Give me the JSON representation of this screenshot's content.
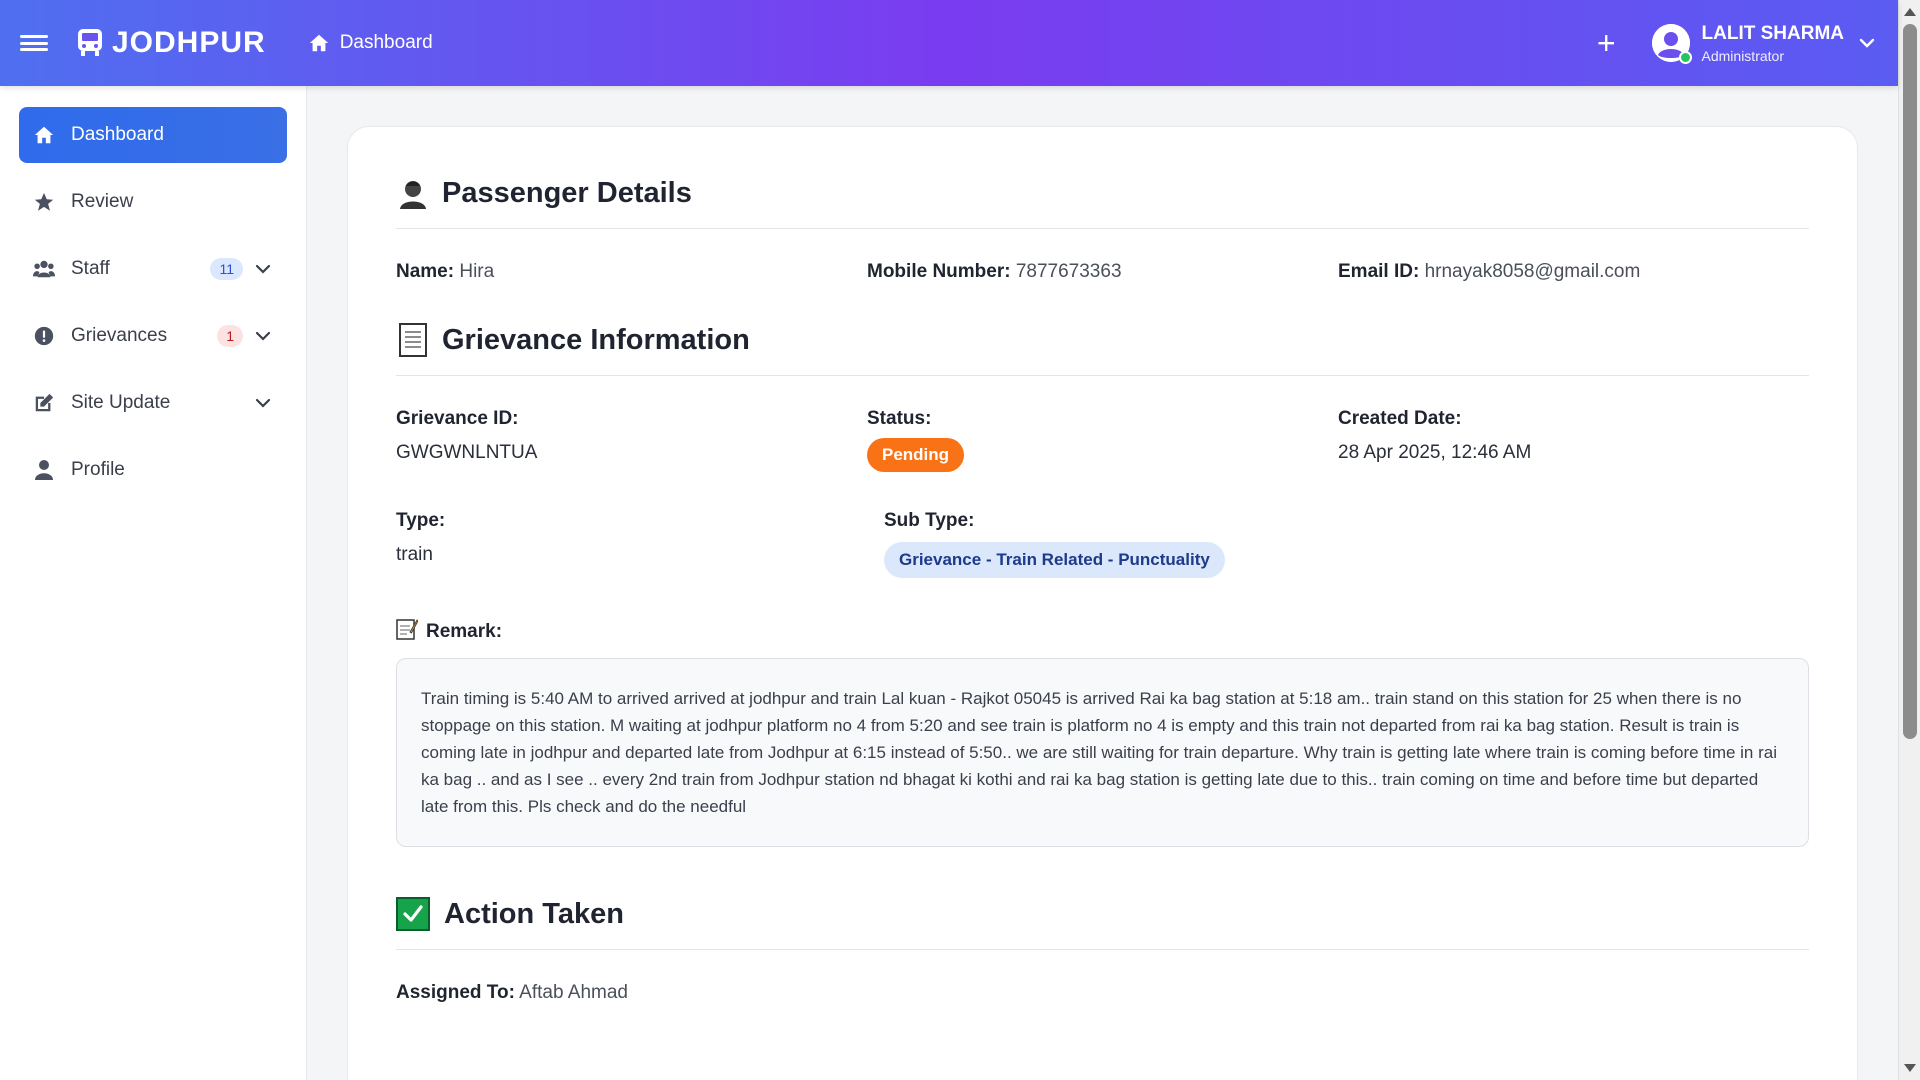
{
  "header": {
    "brand": "JODHPUR",
    "breadcrumb": "Dashboard",
    "user_name": "LALIT SHARMA",
    "user_role": "Administrator"
  },
  "sidebar": {
    "items": [
      {
        "label": "Dashboard",
        "icon": "home-icon",
        "active": true
      },
      {
        "label": "Review",
        "icon": "star-icon"
      },
      {
        "label": "Staff",
        "icon": "users-icon",
        "badge": "11"
      },
      {
        "label": "Grievances",
        "icon": "alert-icon",
        "badge": "1"
      },
      {
        "label": "Site Update",
        "icon": "edit-icon"
      },
      {
        "label": "Profile",
        "icon": "user-icon"
      }
    ]
  },
  "passenger": {
    "title": "Passenger Details",
    "name_label": "Name:",
    "name": "Hira",
    "mobile_label": "Mobile Number:",
    "mobile": "7877673363",
    "email_label": "Email ID:",
    "email": "hrnayak8058@gmail.com"
  },
  "grievance": {
    "title": "Grievance Information",
    "id_label": "Grievance ID:",
    "id": "GWGWNLNTUA",
    "status_label": "Status:",
    "status": "Pending",
    "created_label": "Created Date:",
    "created": "28 Apr 2025, 12:46 AM",
    "type_label": "Type:",
    "type": "train",
    "subtype_label": "Sub Type:",
    "subtype": "Grievance - Train Related - Punctuality",
    "remark_label": "Remark:",
    "remark": "Train timing is 5:40 AM to arrived arrived at jodhpur and train Lal kuan - Rajkot 05045 is arrived Rai ka bag station at 5:18 am.. train stand on this station for 25 when there is no stoppage on this station. M waiting at jodhpur platform no 4 from 5:20 and see train is platform no 4 is empty and this train not departed from rai ka bag station. Result is train is coming late in jodhpur and departed late from Jodhpur at 6:15 instead of 5:50.. we are still waiting for train departure. Why train is getting late where train is coming before time in rai ka bag .. and as I see .. every 2nd train from Jodhpur station nd bhagat ki kothi and rai ka bag station is getting late due to this.. train coming on time and before time but departed late from this. Pls check and do the needful"
  },
  "action": {
    "title": "Action Taken",
    "assigned_label": "Assigned To:",
    "assigned": "Aftab Ahmad"
  },
  "colors": {
    "accent": "#2f6bec",
    "pending": "#f97316",
    "subtype_bg": "#dbe7fb",
    "online": "#22c55e"
  }
}
